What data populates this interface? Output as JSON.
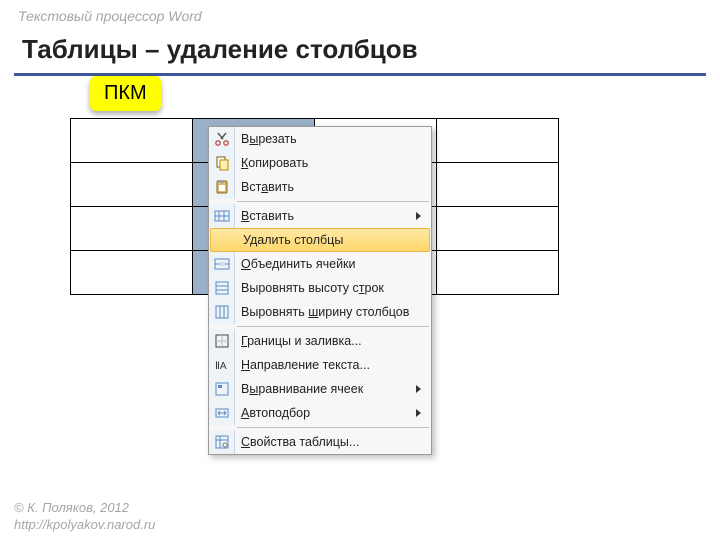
{
  "header": {
    "category": "Текстовый процессор Word",
    "title": "Таблицы – удаление столбцов"
  },
  "badge": "ПКМ",
  "context_menu": {
    "items": [
      {
        "label": "В<u>ы</u>резать",
        "icon": "cut-icon"
      },
      {
        "label": "<u>К</u>опировать",
        "icon": "copy-icon"
      },
      {
        "label": "Вст<u>а</u>вить",
        "icon": "paste-icon"
      },
      {
        "sep": true
      },
      {
        "label": "<u>В</u>ставить",
        "icon": "insert-icon",
        "submenu": true
      },
      {
        "label": "Удалить столбцы",
        "icon": "delete-columns-icon",
        "highlight": true
      },
      {
        "label": "<u>О</u>бъединить ячейки",
        "icon": "merge-cells-icon"
      },
      {
        "label": "Выровнять высоту с<u>т</u>рок",
        "icon": "distribute-rows-icon"
      },
      {
        "label": "Выровнять <u>ш</u>ирину столбцов",
        "icon": "distribute-columns-icon"
      },
      {
        "sep": true
      },
      {
        "label": "<u>Г</u>раницы и заливка...",
        "icon": "borders-icon"
      },
      {
        "label": "<u>Н</u>аправление текста...",
        "icon": "text-direction-icon"
      },
      {
        "label": "В<u>ы</u>равнивание ячеек",
        "icon": "cell-alignment-icon",
        "submenu": true
      },
      {
        "label": "<u>А</u>втоподбор",
        "icon": "autofit-icon",
        "submenu": true
      },
      {
        "sep": true
      },
      {
        "label": "<u>С</u>войства таблицы...",
        "icon": "table-properties-icon"
      }
    ]
  },
  "footer": {
    "copyright": "© К. Поляков, 2012",
    "url": "http://kpolyakov.narod.ru"
  },
  "table": {
    "rows": 4,
    "cols": 4,
    "selected_col": 1
  }
}
